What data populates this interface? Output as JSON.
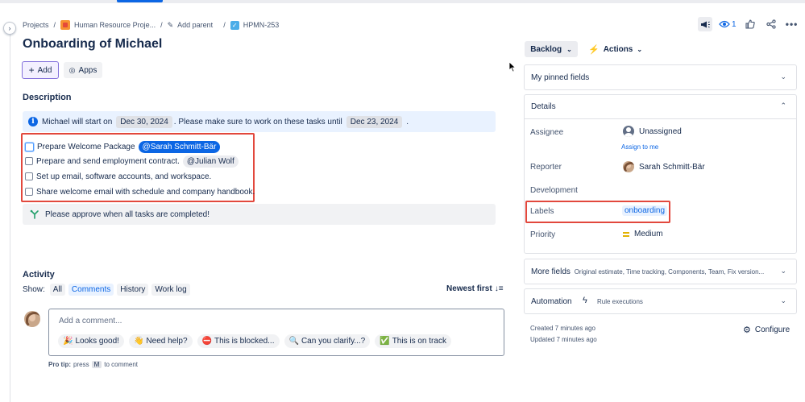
{
  "breadcrumb": {
    "projects": "Projects",
    "project": "Human Resource Proje...",
    "add_parent": "Add parent",
    "issue_key": "HPMN-253"
  },
  "issue": {
    "title": "Onboarding of Michael",
    "add_label": "Add",
    "apps_label": "Apps"
  },
  "description": {
    "heading": "Description",
    "info": {
      "text1": "Michael will start on",
      "date1": "Dec 30, 2024",
      "text2": ". Please make sure to work on these tasks until",
      "date2": "Dec 23, 2024",
      "text3": "."
    },
    "tasks": [
      {
        "text": "Prepare Welcome Package",
        "mention": "@Sarah Schmitt-Bär"
      },
      {
        "text": "Prepare and send employment contract.",
        "mention": "@Julian Wolf"
      },
      {
        "text": "Set up email, software accounts, and workspace.",
        "mention": ""
      },
      {
        "text": "Share welcome email with schedule and company handbook.",
        "mention": ""
      }
    ],
    "approve": "Please approve when all tasks are completed!"
  },
  "activity": {
    "heading": "Activity",
    "show_label": "Show:",
    "filters": [
      "All",
      "Comments",
      "History",
      "Work log"
    ],
    "active_filter": "Comments",
    "sort": "Newest first",
    "comment_placeholder": "Add a comment...",
    "quick_replies": [
      {
        "emoji": "🎉",
        "label": "Looks good!"
      },
      {
        "emoji": "👋",
        "label": "Need help?"
      },
      {
        "emoji": "⛔",
        "label": "This is blocked..."
      },
      {
        "emoji": "🔍",
        "label": "Can you clarify...?"
      },
      {
        "emoji": "✅",
        "label": "This is on track"
      }
    ],
    "protip_bold": "Pro tip:",
    "protip_press": "press",
    "protip_key": "M",
    "protip_rest": "to comment"
  },
  "header_actions": {
    "watch_count": "1"
  },
  "sidebar": {
    "status": "Backlog",
    "actions": "Actions",
    "pinned": "My pinned fields",
    "details": "Details",
    "fields": {
      "assignee_label": "Assignee",
      "assignee_value": "Unassigned",
      "assign_to_me": "Assign to me",
      "reporter_label": "Reporter",
      "reporter_value": "Sarah Schmitt-Bär",
      "development_label": "Development",
      "labels_label": "Labels",
      "labels_value": "onboarding",
      "priority_label": "Priority",
      "priority_value": "Medium"
    },
    "more_fields": "More fields",
    "more_fields_list": "Original estimate, Time tracking, Components, Team, Fix version...",
    "automation": "Automation",
    "rule_executions": "Rule executions",
    "created": "Created 7 minutes ago",
    "updated": "Updated 7 minutes ago",
    "configure": "Configure"
  },
  "colors": {
    "accent": "#0c66e4",
    "highlight_border": "#e2483d",
    "info_bg": "#e9f2ff"
  }
}
